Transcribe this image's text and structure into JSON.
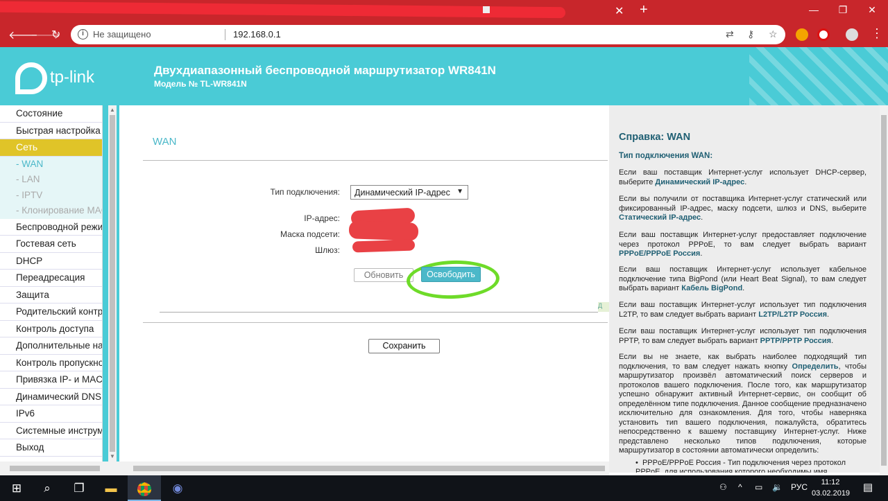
{
  "browser": {
    "address_security": "Не защищено",
    "url": "192.168.0.1"
  },
  "header": {
    "logo_text": "tp-link",
    "title": "Двухдиапазонный беспроводной маршрутизатор WR841N",
    "model": "Модель № TL-WR841N"
  },
  "sidebar": {
    "items": [
      {
        "label": "Состояние"
      },
      {
        "label": "Быстрая настройка"
      },
      {
        "label": "Сеть",
        "active": true
      },
      {
        "label": "- WAN",
        "sub": true,
        "active": true
      },
      {
        "label": "- LAN",
        "sub": true
      },
      {
        "label": "- IPTV",
        "sub": true
      },
      {
        "label": "- Клонирование MAC",
        "sub": true
      },
      {
        "label": "Беспроводной режим"
      },
      {
        "label": "Гостевая сеть"
      },
      {
        "label": "DHCP"
      },
      {
        "label": "Переадресация"
      },
      {
        "label": "Защита"
      },
      {
        "label": "Родительский контроль"
      },
      {
        "label": "Контроль доступа"
      },
      {
        "label": "Дополнительные настройки"
      },
      {
        "label": "Контроль пропускной"
      },
      {
        "label": "Привязка IP- и MAC-"
      },
      {
        "label": "Динамический DNS"
      },
      {
        "label": "IPv6"
      },
      {
        "label": "Системные инструменты"
      },
      {
        "label": "Выход"
      }
    ]
  },
  "main": {
    "title": "WAN",
    "conn_type_label": "Тип подключения:",
    "conn_type_value": "Динамический IP-адрес",
    "ip_label": "IP-адрес:",
    "mask_label": "Маска подсети:",
    "gateway_label": "Шлюз:",
    "refresh_button": "Обновить",
    "release_button": "Освободить",
    "help_tag": "Д",
    "save_button": "Сохранить"
  },
  "help": {
    "title": "Справка: WAN",
    "subtitle": "Тип подключения WAN:",
    "p1": "Если ваш поставщик Интернет-услуг использует DHCP-сервер, выберите ",
    "p1_link": "Динамический IP-адрес",
    "p2": "Если вы получили от поставщика Интернет-услуг статический или фиксированный IP-адрес, маску подсети, шлюз и DNS, выберите ",
    "p2_link": "Статический IP-адрес",
    "p3": "Если ваш поставщик Интернет-услуг предоставляет подключение через протокол PPPoE, то вам следует выбрать вариант ",
    "p3_link": "PPPoE/PPPoE Россия",
    "p4": "Если ваш поставщик Интернет-услуг использует кабельное подключение типа BigPond (или Heart Beat Signal), то вам следует выбрать вариант ",
    "p4_link": "Кабель BigPond",
    "p5": "Если ваш поставщик Интернет-услуг использует тип подключения L2TP, то вам следует выбрать вариант ",
    "p5_link": "L2TP/L2TP Россия",
    "p6": "Если ваш поставщик Интернет-услуг использует тип подключения PPTP, то вам следует выбрать вариант ",
    "p6_link": "PPTP/PPTP Россия",
    "p7a": "Если вы не знаете, как выбрать наиболее подходящий тип подключения, то вам следует нажать кнопку ",
    "p7_link": "Определить",
    "p7b": ", чтобы маршрутизатор произвёл автоматический поиск серверов и протоколов вашего подключения. После того, как маршрутизатор успешно обнаружит активный Интернет-сервис, он сообщит об определённом типе подключения. Данное сообщение предназначено исключительно для ознакомления. Для того, чтобы наверняка установить тип вашего подключения, пожалуйста, обратитесь непосредственно к вашему поставщику Интернет-услуг. Ниже представлено несколько типов подключения, которые маршрутизатор в состоянии автоматически определить:",
    "bullet1": "PPPoE/PPPoE Россия - Тип подключения через протокол PPPoE, для использования которого необходимы имя"
  },
  "taskbar": {
    "lang": "РУС",
    "time": "11:12",
    "date": "03.02.2019"
  },
  "colors": {
    "accent": "#4acbd6",
    "active_menu": "#e0c428",
    "browser_frame": "#c8262b"
  }
}
